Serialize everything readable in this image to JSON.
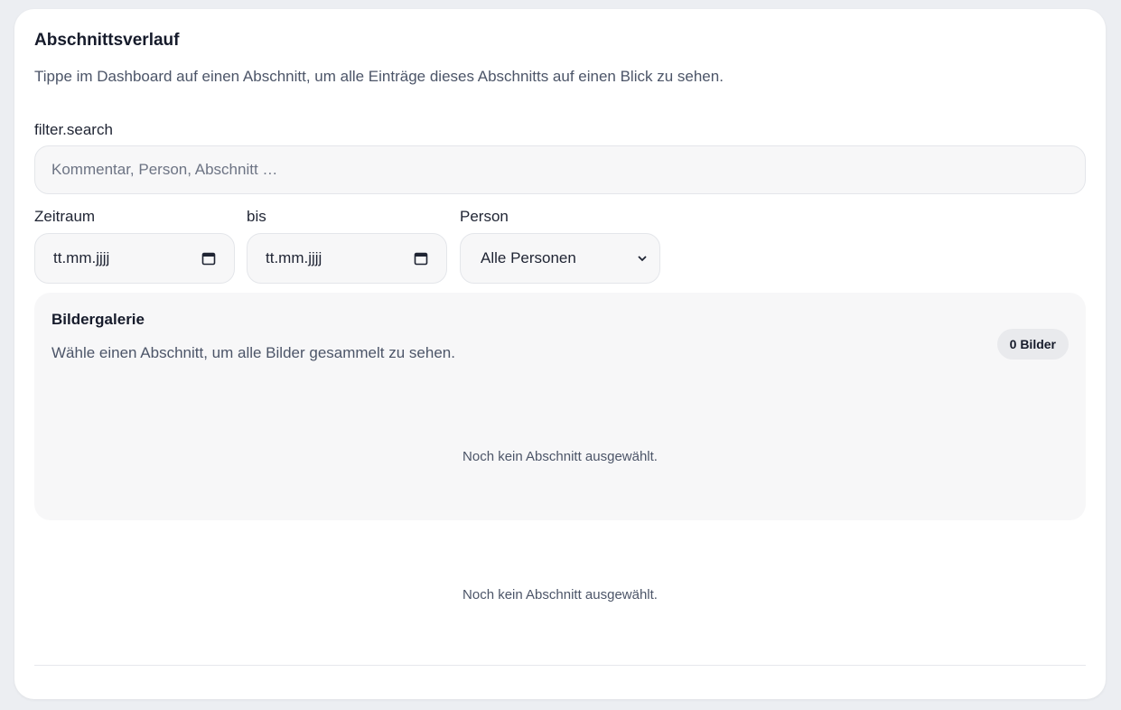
{
  "history": {
    "title": "Abschnittsverlauf",
    "subtitle": "Tippe im Dashboard auf einen Abschnitt, um alle Einträge dieses Abschnitts auf einen Blick zu sehen."
  },
  "filter": {
    "search_label": "filter.search",
    "search_placeholder": "Kommentar, Person, Abschnitt …",
    "from_label": "Zeitraum",
    "from_value": "tt.mm.jjjj",
    "to_label": "bis",
    "to_value": "tt.mm.jjjj",
    "person_label": "Person",
    "person_selected": "Alle Personen"
  },
  "gallery": {
    "title": "Bildergalerie",
    "subtitle": "Wähle einen Abschnitt, um alle Bilder gesammelt zu sehen.",
    "count_badge": "0 Bilder",
    "empty_text": "Noch kein Abschnitt ausgewählt."
  },
  "entries": {
    "empty_text": "Noch kein Abschnitt ausgewählt."
  },
  "icons": {
    "date_picker": "calendar-icon",
    "select_arrow": "chevron-down-icon"
  }
}
